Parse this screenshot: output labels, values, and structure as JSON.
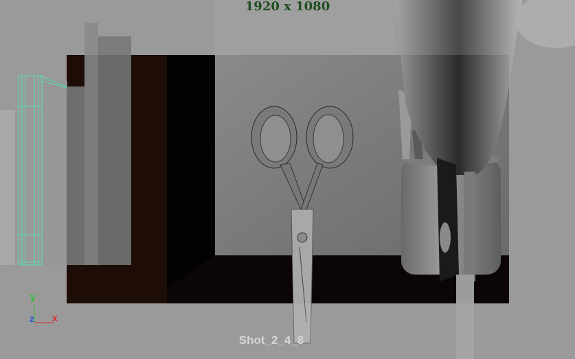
{
  "viewport": {
    "resolution_label": "1920 x 1080",
    "camera_name": "Shot_2_4_8"
  },
  "axis_gizmo": {
    "y_label": "y",
    "z_label": "z",
    "x_label": "x",
    "y_color": "#2fbf2f",
    "z_color": "#3a55d8",
    "x_color": "#e02a2a"
  },
  "colors": {
    "background": "#8c8c8c",
    "overscan_tint": "#a8a8a8",
    "wall_dark": "#120605",
    "shelf_brown": "#1e0d07",
    "wireframe": "#3ee0a0",
    "resolution_text": "#1f4d1f"
  }
}
